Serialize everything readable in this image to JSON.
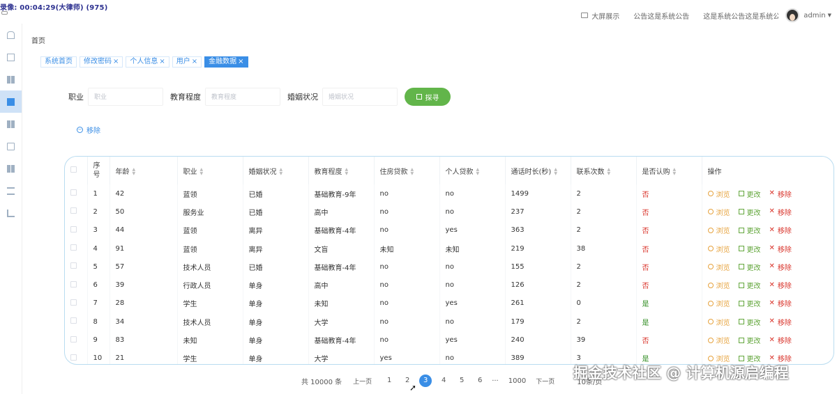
{
  "recording": "录像: 00:04:29(大律师) (975)",
  "topbar": {
    "bigscreen": "大屏展示",
    "notice1": "公告这是系统公告",
    "notice2": "这是系统公告这是系统公告",
    "user": "admin"
  },
  "breadcrumb": "首页",
  "tabs": [
    {
      "label": "系统首页",
      "closable": false
    },
    {
      "label": "修改密码",
      "closable": true
    },
    {
      "label": "个人信息",
      "closable": true
    },
    {
      "label": "用户",
      "closable": true
    },
    {
      "label": "金融数据",
      "closable": true
    }
  ],
  "search": {
    "job_label": "职业",
    "job_placeholder": "职业",
    "edu_label": "教育程度",
    "edu_placeholder": "教育程度",
    "marital_label": "婚姻状况",
    "marital_placeholder": "婚姻状况",
    "button": "探寻"
  },
  "remove_all": "移除",
  "table": {
    "headers": [
      "序号",
      "年龄",
      "职业",
      "婚姻状况",
      "教育程度",
      "住房贷款",
      "个人贷款",
      "通话时长(秒)",
      "联系次数",
      "是否认购",
      "操作"
    ],
    "actions": {
      "view": "浏览",
      "edit": "更改",
      "delete": "移除"
    },
    "rows": [
      [
        "1",
        "42",
        "蓝领",
        "已婚",
        "基础教育-9年",
        "no",
        "no",
        "1499",
        "2",
        "否"
      ],
      [
        "2",
        "50",
        "服务业",
        "已婚",
        "高中",
        "no",
        "no",
        "237",
        "2",
        "否"
      ],
      [
        "3",
        "44",
        "蓝领",
        "离异",
        "基础教育-4年",
        "no",
        "yes",
        "363",
        "2",
        "否"
      ],
      [
        "4",
        "91",
        "蓝领",
        "离异",
        "文盲",
        "未知",
        "未知",
        "219",
        "38",
        "否"
      ],
      [
        "5",
        "57",
        "技术人员",
        "已婚",
        "基础教育-4年",
        "no",
        "no",
        "155",
        "2",
        "否"
      ],
      [
        "6",
        "39",
        "行政人员",
        "单身",
        "高中",
        "no",
        "no",
        "126",
        "2",
        "否"
      ],
      [
        "7",
        "28",
        "学生",
        "单身",
        "未知",
        "no",
        "yes",
        "261",
        "0",
        "是"
      ],
      [
        "8",
        "34",
        "技术人员",
        "单身",
        "大学",
        "no",
        "no",
        "179",
        "2",
        "是"
      ],
      [
        "9",
        "83",
        "未知",
        "单身",
        "基础教育-4年",
        "no",
        "yes",
        "240",
        "39",
        "否"
      ],
      [
        "10",
        "21",
        "学生",
        "单身",
        "大学",
        "yes",
        "no",
        "389",
        "3",
        "是"
      ]
    ]
  },
  "pager": {
    "total": "共 10000 条",
    "prev": "上一页",
    "pages": [
      "1",
      "2",
      "3",
      "4",
      "5",
      "6"
    ],
    "active": "3",
    "ellipsis": "···",
    "last": "1000",
    "next": "下一页",
    "size": "10条/页"
  },
  "watermark": "掘金技术社区 @ 计算机源启编程"
}
